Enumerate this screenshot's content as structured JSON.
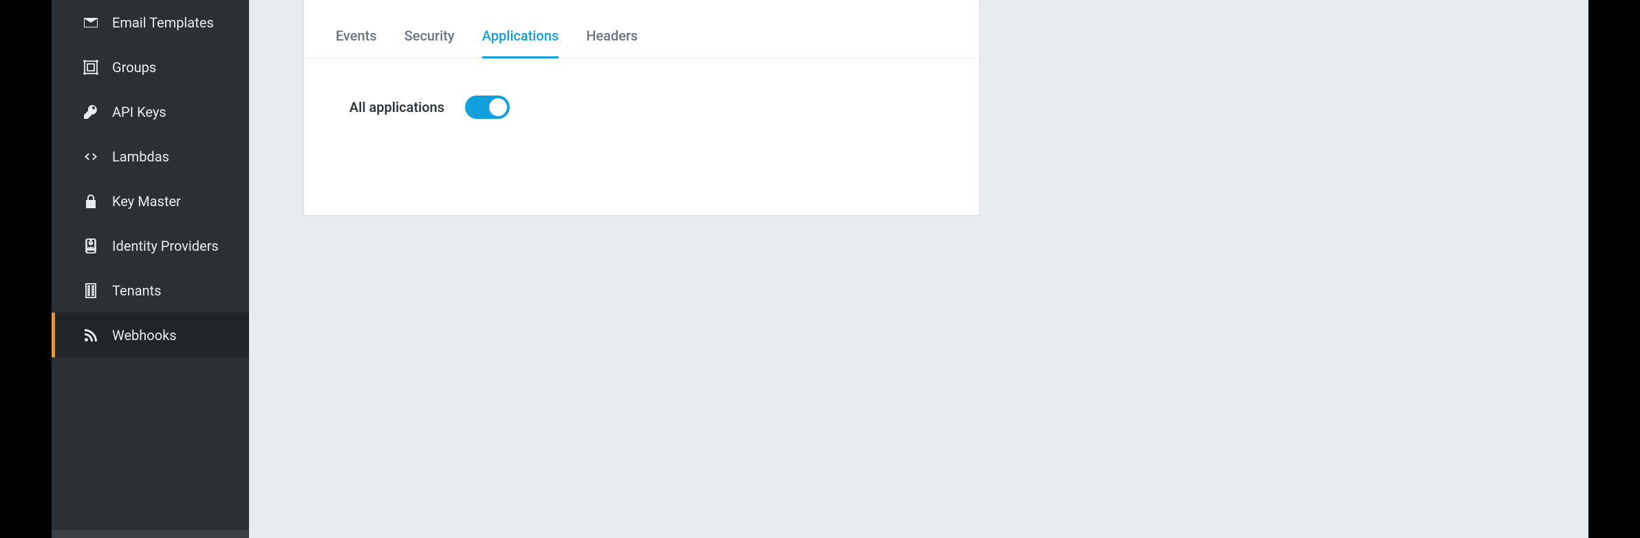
{
  "sidebar": {
    "items": [
      {
        "id": "email-templates",
        "label": "Email Templates",
        "icon": "envelope-icon",
        "active": false
      },
      {
        "id": "groups",
        "label": "Groups",
        "icon": "group-icon",
        "active": false
      },
      {
        "id": "api-keys",
        "label": "API Keys",
        "icon": "key-icon",
        "active": false
      },
      {
        "id": "lambdas",
        "label": "Lambdas",
        "icon": "code-icon",
        "active": false
      },
      {
        "id": "key-master",
        "label": "Key Master",
        "icon": "lock-icon",
        "active": false
      },
      {
        "id": "identity-providers",
        "label": "Identity Providers",
        "icon": "id-badge-icon",
        "active": false
      },
      {
        "id": "tenants",
        "label": "Tenants",
        "icon": "building-icon",
        "active": false
      },
      {
        "id": "webhooks",
        "label": "Webhooks",
        "icon": "rss-icon",
        "active": true
      }
    ]
  },
  "main": {
    "tabs": [
      {
        "id": "events",
        "label": "Events",
        "active": false
      },
      {
        "id": "security",
        "label": "Security",
        "active": false
      },
      {
        "id": "applications",
        "label": "Applications",
        "active": true
      },
      {
        "id": "headers",
        "label": "Headers",
        "active": false
      }
    ],
    "applications_panel": {
      "all_applications_label": "All applications",
      "all_applications_enabled": true
    }
  },
  "colors": {
    "accent": "#129fdb",
    "sidebar_bg": "#2b3034",
    "sidebar_active_bg": "#212529",
    "sidebar_active_indicator": "#f7931e"
  }
}
